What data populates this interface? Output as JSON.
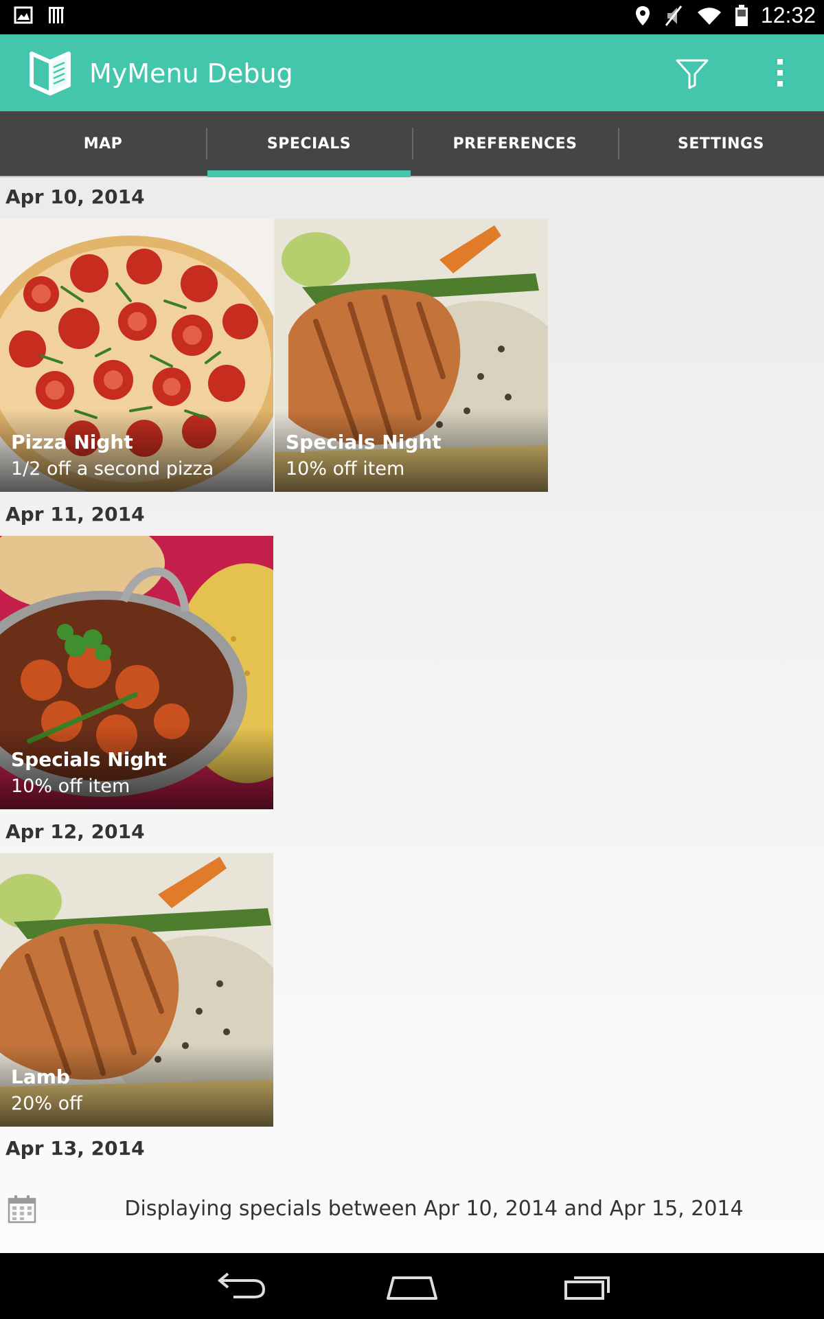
{
  "status_bar": {
    "time": "12:32",
    "icons": [
      "image-icon",
      "barcode-icon",
      "location-icon",
      "mute-icon",
      "wifi-icon",
      "battery-icon"
    ]
  },
  "action_bar": {
    "title": "MyMenu Debug",
    "icons": [
      "app-logo-icon",
      "filter-icon",
      "overflow-menu-icon"
    ],
    "color": "#43c6ac"
  },
  "tabs": [
    {
      "label": "MAP",
      "active": false
    },
    {
      "label": "SPECIALS",
      "active": true
    },
    {
      "label": "PREFERENCES",
      "active": false
    },
    {
      "label": "SETTINGS",
      "active": false
    }
  ],
  "sections": [
    {
      "date": "Apr 10, 2014",
      "specials": [
        {
          "title": "Pizza Night",
          "subtitle": "1/2 off a second pizza",
          "image": "pizza"
        },
        {
          "title": "Specials Night",
          "subtitle": "10% off item",
          "image": "grilled-fish"
        }
      ]
    },
    {
      "date": "Apr 11, 2014",
      "specials": [
        {
          "title": "Specials Night",
          "subtitle": "10% off item",
          "image": "curry"
        }
      ]
    },
    {
      "date": "Apr 12, 2014",
      "specials": [
        {
          "title": "Lamb",
          "subtitle": "20% off",
          "image": "grilled-fish"
        }
      ]
    },
    {
      "date": "Apr 13, 2014",
      "specials": []
    }
  ],
  "footer": {
    "text": "Displaying specials between Apr 10, 2014 and Apr 15, 2014",
    "icon": "calendar-icon"
  },
  "nav_bar": {
    "icons": [
      "back-icon",
      "home-icon",
      "recent-apps-icon"
    ]
  }
}
